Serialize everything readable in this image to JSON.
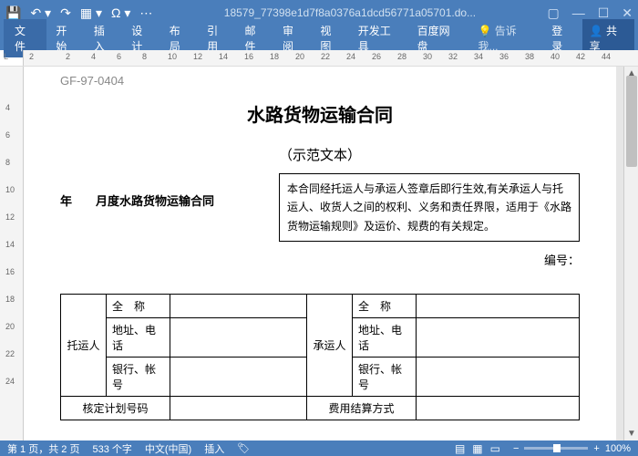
{
  "titlebar": {
    "filename": "18579_77398e1d7f8a0376a1dcd56771a05701.do..."
  },
  "menu": {
    "file": "文件",
    "items": [
      "开始",
      "插入",
      "设计",
      "布局",
      "引用",
      "邮件",
      "审阅",
      "视图",
      "开发工具",
      "百度网盘"
    ],
    "tell": "告诉我...",
    "login": "登录",
    "share": "共享"
  },
  "ruler": {
    "corner": "L",
    "h": [
      "2",
      "",
      "2",
      "4",
      "6",
      "8",
      "10",
      "12",
      "14",
      "16",
      "18",
      "20",
      "22",
      "24",
      "26",
      "28",
      "30",
      "32",
      "34",
      "36",
      "38",
      "40",
      "42",
      "44"
    ],
    "v": [
      "",
      "4",
      "6",
      "8",
      "10",
      "12",
      "14",
      "16",
      "18",
      "20",
      "22",
      "24"
    ]
  },
  "doc": {
    "code": "GF-97-0404",
    "title": "水路货物运输合同",
    "subtitle": "（示范文本）",
    "leftline": "年　　月度水路货物运输合同",
    "boxtext": "本合同经托运人与承运人签章后即行生效,有关承运人与托运人、收货人之间的权利、义务和责任界限，适用于《水路货物运输规则》及运价、规费的有关规定。",
    "bianhao": "编号：",
    "table": {
      "t_shipper": "托运人",
      "t_carrier": "承运人",
      "r_fullname": "全　称",
      "r_addrtel": "地址、电话",
      "r_bankacct": "银行、帐号",
      "r_plan": "核定计划号码",
      "r_settle": "费用结算方式"
    }
  },
  "status": {
    "page": "第 1 页，共 2 页",
    "words": "533 个字",
    "lang": "中文(中国)",
    "mode": "插入",
    "zoom": "100%"
  }
}
